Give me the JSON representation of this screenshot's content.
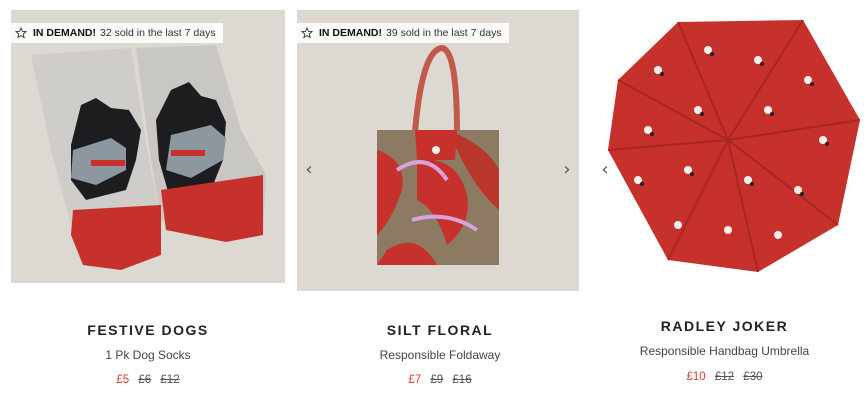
{
  "products": [
    {
      "badge_strong": "IN DEMAND!",
      "badge_text": "32 sold in the last 7 days",
      "title": "FESTIVE DOGS",
      "subtitle": "1 Pk Dog Socks",
      "price_now": "£5",
      "price_was": "£6",
      "price_original": "£12",
      "image_icon": "dog-socks-image"
    },
    {
      "badge_strong": "IN DEMAND!",
      "badge_text": "39 sold in the last 7 days",
      "title": "SILT FLORAL",
      "subtitle": "Responsible Foldaway",
      "price_now": "£7",
      "price_was": "£9",
      "price_original": "£16",
      "image_icon": "floral-tote-bag-image",
      "prev_arrow": "‹",
      "next_arrow": "›"
    },
    {
      "title": "RADLEY JOKER",
      "subtitle": "Responsible Handbag Umbrella",
      "price_now": "£10",
      "price_was": "£12",
      "price_original": "£30",
      "image_icon": "red-umbrella-image",
      "prev_arrow": "‹"
    }
  ],
  "colors": {
    "sale_price": "#d4412e",
    "title": "#222222",
    "accent_red": "#c7312b"
  }
}
